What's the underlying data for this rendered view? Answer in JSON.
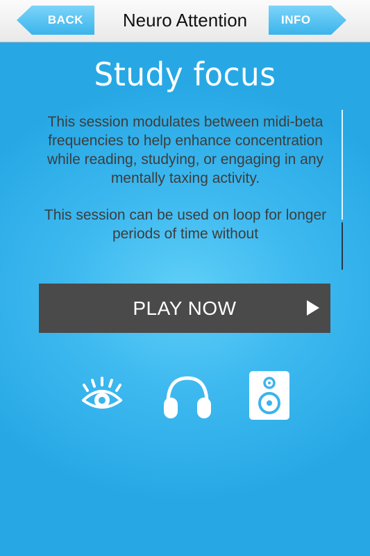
{
  "nav": {
    "back_label": "BACK",
    "title": "Neuro Attention",
    "info_label": "INFO"
  },
  "session": {
    "title": "Study focus",
    "description": [
      "This session modulates between midi-beta frequencies to help enhance concentration while reading, studying, or engaging in any mentally taxing activity.",
      "This session can be used on loop for longer periods of time without"
    ]
  },
  "play": {
    "label": "PLAY NOW",
    "icon": "play-icon"
  },
  "modes": [
    {
      "icon": "eye-icon"
    },
    {
      "icon": "headphones-icon"
    },
    {
      "icon": "speaker-icon"
    }
  ],
  "colors": {
    "background": "#3fbaf0",
    "button_blue": "#4fc1f1",
    "play_button": "#4a4a4a",
    "description_text": "#3d3d3d"
  }
}
